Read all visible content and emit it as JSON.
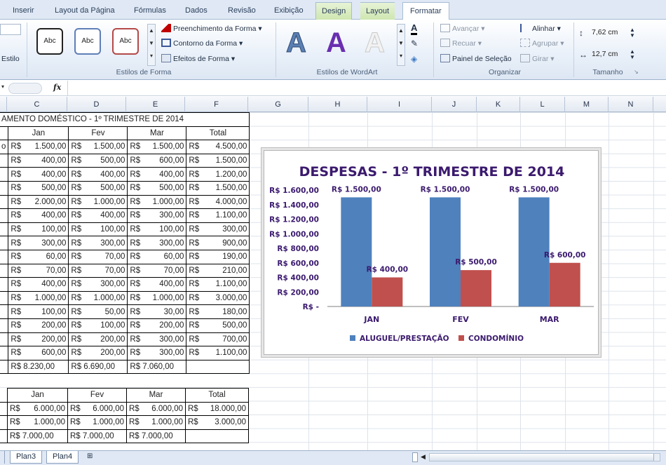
{
  "ribbon_tabs": [
    "Inserir",
    "Layout da Página",
    "Fórmulas",
    "Dados",
    "Revisão",
    "Exibição",
    "Design",
    "Layout",
    "Formatar"
  ],
  "ribbon": {
    "left_label": "Estilo",
    "shape_style_sample": "Abc",
    "shape_fill": "Preenchimento da Forma",
    "shape_outline": "Contorno da Forma",
    "shape_effects": "Efeitos de Forma",
    "group_shape_styles": "Estilos de Forma",
    "wordart_letter": "A",
    "group_wordart": "Estilos de WordArt",
    "bring_forward": "Avançar",
    "send_back": "Recuar",
    "selection_pane": "Painel de Seleção",
    "align": "Alinhar",
    "group": "Agrupar",
    "rotate": "Girar",
    "group_arrange": "Organizar",
    "height": "7,62 cm",
    "width": "12,7 cm",
    "group_size": "Tamanho"
  },
  "formula_bar": {
    "fx": "fx",
    "value": ""
  },
  "columns": [
    "C",
    "D",
    "E",
    "F",
    "G",
    "H",
    "I",
    "J",
    "K",
    "L",
    "M",
    "N"
  ],
  "sheet": {
    "title": "AMENTO DOMÉSTICO - 1º TRIMESTRE DE 2014",
    "headers": [
      "Jan",
      "Fev",
      "Mar",
      "Total"
    ],
    "left_fragment": "o",
    "rows": [
      [
        "1.500,00",
        "1.500,00",
        "1.500,00",
        "4.500,00"
      ],
      [
        "400,00",
        "500,00",
        "600,00",
        "1.500,00"
      ],
      [
        "400,00",
        "400,00",
        "400,00",
        "1.200,00"
      ],
      [
        "500,00",
        "500,00",
        "500,00",
        "1.500,00"
      ],
      [
        "2.000,00",
        "1.000,00",
        "1.000,00",
        "4.000,00"
      ],
      [
        "400,00",
        "400,00",
        "300,00",
        "1.100,00"
      ],
      [
        "100,00",
        "100,00",
        "100,00",
        "300,00"
      ],
      [
        "300,00",
        "300,00",
        "300,00",
        "900,00"
      ],
      [
        "60,00",
        "70,00",
        "60,00",
        "190,00"
      ],
      [
        "70,00",
        "70,00",
        "70,00",
        "210,00"
      ],
      [
        "400,00",
        "300,00",
        "400,00",
        "1.100,00"
      ],
      [
        "1.000,00",
        "1.000,00",
        "1.000,00",
        "3.000,00"
      ],
      [
        "100,00",
        "50,00",
        "30,00",
        "180,00"
      ],
      [
        "200,00",
        "100,00",
        "200,00",
        "500,00"
      ],
      [
        "200,00",
        "200,00",
        "300,00",
        "700,00"
      ],
      [
        "600,00",
        "200,00",
        "300,00",
        "1.100,00"
      ]
    ],
    "totals": [
      "R$ 8.230,00",
      "R$ 6.690,00",
      "R$ 7.060,00",
      ""
    ],
    "currency": "R$",
    "summary_headers": [
      "Jan",
      "Fev",
      "Mar",
      "Total"
    ],
    "summary_rows": [
      [
        "6.000,00",
        "6.000,00",
        "6.000,00",
        "18.000,00"
      ],
      [
        "1.000,00",
        "1.000,00",
        "1.000,00",
        "3.000,00"
      ]
    ],
    "summary_totals": [
      "R$ 7.000,00",
      "R$ 7.000,00",
      "R$ 7.000,00",
      ""
    ]
  },
  "chart_data": {
    "type": "bar",
    "title": "DESPESAS - 1º TRIMESTRE DE 2014",
    "categories": [
      "JAN",
      "FEV",
      "MAR"
    ],
    "series": [
      {
        "name": "ALUGUEL/PRESTAÇÃO",
        "values": [
          1500,
          1500,
          1500
        ],
        "labels": [
          "R$ 1.500,00",
          "R$ 1.500,00",
          "R$ 1.500,00"
        ],
        "color": "#4f81bd"
      },
      {
        "name": "CONDOMÍNIO",
        "values": [
          400,
          500,
          600
        ],
        "labels": [
          "R$ 400,00",
          "R$ 500,00",
          "R$ 600,00"
        ],
        "color": "#c0504d"
      }
    ],
    "ylim": [
      0,
      1600
    ],
    "yticks": [
      0,
      200,
      400,
      600,
      800,
      1000,
      1200,
      1400,
      1600
    ],
    "ytick_labels": [
      "R$ -",
      "R$ 200,00",
      "R$ 400,00",
      "R$ 600,00",
      "R$ 800,00",
      "R$ 1.000,00",
      "R$ 1.200,00",
      "R$ 1.400,00",
      "R$ 1.600,00"
    ],
    "legend": "bottom",
    "grid": false,
    "title_color": "#3b1a6e"
  },
  "sheet_tabs": [
    "Plan3",
    "Plan4"
  ]
}
